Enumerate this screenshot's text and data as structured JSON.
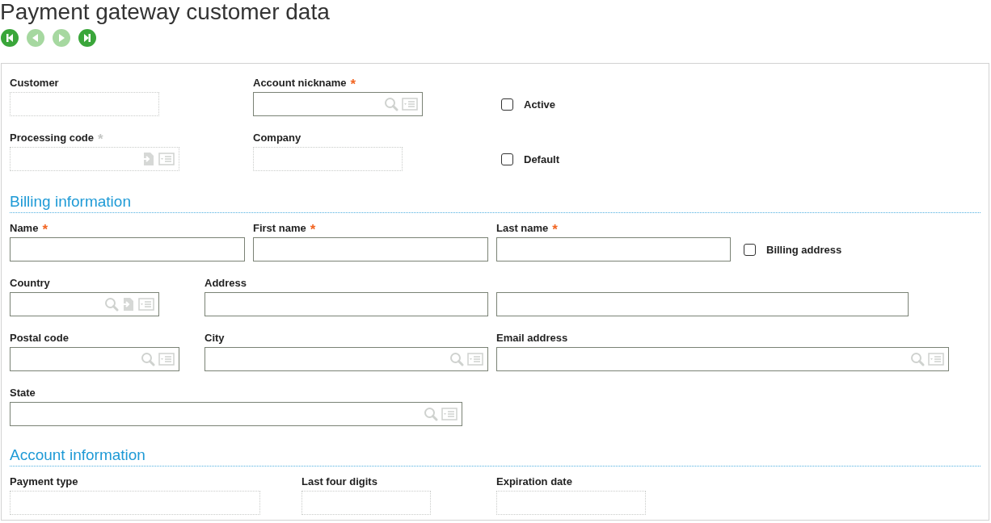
{
  "title": "Payment gateway customer data",
  "nav": [
    {
      "kind": "first",
      "disabled": false
    },
    {
      "kind": "previous",
      "disabled": true
    },
    {
      "kind": "next",
      "disabled": true
    },
    {
      "kind": "last",
      "disabled": false
    }
  ],
  "sections": [
    {
      "rows": [
        [
          {
            "kind": "field",
            "label": "Customer",
            "readonly": true
          },
          {
            "kind": "field",
            "label": "Account nickname",
            "marker": "*",
            "required": true,
            "readonly": false,
            "buttons": [
              {
                "kind": "search"
              },
              {
                "kind": "list"
              }
            ]
          },
          {
            "kind": "checkbox",
            "label": "Active",
            "checked": false
          }
        ],
        [
          {
            "kind": "field",
            "label": "Processing code",
            "marker": "*",
            "required": false,
            "readonly": true,
            "buttons": [
              {
                "kind": "open"
              },
              {
                "kind": "list"
              }
            ]
          },
          {
            "kind": "field",
            "label": "Company",
            "readonly": true
          },
          {
            "kind": "checkbox",
            "label": "Default",
            "checked": false
          }
        ]
      ]
    },
    {
      "heading": "Billing information",
      "rows": [
        [
          {
            "kind": "field",
            "label": "Name",
            "marker": "*",
            "required": true,
            "readonly": false
          },
          {
            "kind": "field",
            "label": "First name",
            "marker": "*",
            "required": true,
            "readonly": false
          },
          {
            "kind": "field",
            "label": "Last name",
            "marker": "*",
            "required": true,
            "readonly": false
          },
          {
            "kind": "checkbox",
            "label": "Billing address",
            "checked": false
          }
        ],
        [
          {
            "kind": "field",
            "label": "Country",
            "readonly": false,
            "buttons": [
              {
                "kind": "search"
              },
              {
                "kind": "open"
              },
              {
                "kind": "list"
              }
            ]
          },
          {
            "kind": "field",
            "label": "Address",
            "readonly": false
          },
          {
            "kind": "field",
            "readonly": false
          }
        ],
        [
          {
            "kind": "field",
            "label": "Postal code",
            "readonly": false,
            "buttons": [
              {
                "kind": "search"
              },
              {
                "kind": "list"
              }
            ]
          },
          {
            "kind": "field",
            "label": "City",
            "readonly": false,
            "buttons": [
              {
                "kind": "search"
              },
              {
                "kind": "list"
              }
            ]
          },
          {
            "kind": "field",
            "label": "Email address",
            "readonly": false,
            "buttons": [
              {
                "kind": "search"
              },
              {
                "kind": "list"
              }
            ]
          }
        ],
        [
          {
            "kind": "field",
            "label": "State",
            "readonly": false,
            "buttons": [
              {
                "kind": "search"
              },
              {
                "kind": "list"
              }
            ]
          }
        ]
      ]
    },
    {
      "heading": "Account information",
      "rows": [
        [
          {
            "kind": "field",
            "label": "Payment type",
            "readonly": true
          },
          {
            "kind": "field",
            "label": "Last four digits",
            "readonly": true
          },
          {
            "kind": "field",
            "label": "Expiration date",
            "readonly": true
          }
        ]
      ]
    }
  ]
}
